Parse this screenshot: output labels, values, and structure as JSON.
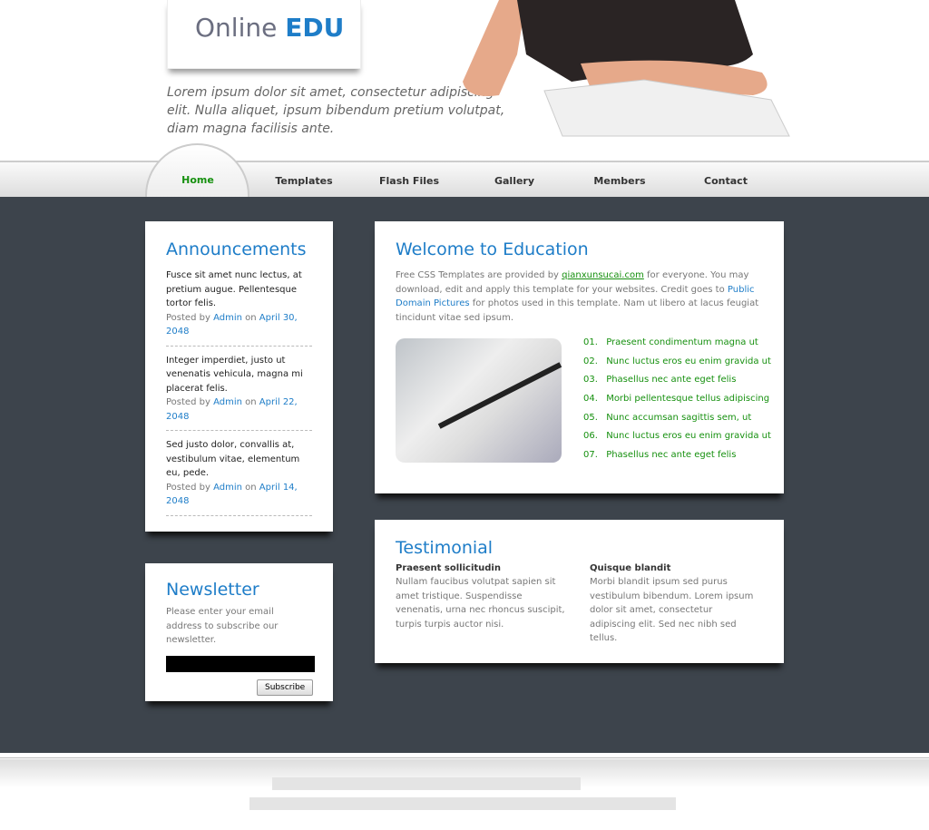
{
  "header": {
    "logo_main": "Online",
    "logo_accent": "EDU",
    "tagline": "Lorem ipsum dolor sit amet, consectetur adipiscing elit. Nulla aliquet, ipsum bibendum pretium volutpat, diam magna facilisis ante."
  },
  "nav": {
    "items": [
      {
        "label": "Home"
      },
      {
        "label": "Templates"
      },
      {
        "label": "Flash Files"
      },
      {
        "label": "Gallery"
      },
      {
        "label": "Members"
      },
      {
        "label": "Contact"
      }
    ],
    "active": "Home"
  },
  "announcements": {
    "title": "Announcements",
    "posted_by": "Posted by",
    "on": "on",
    "posts": [
      {
        "text": "Fusce sit amet nunc lectus, at pretium augue. Pellentesque tortor felis.",
        "author": "Admin",
        "date": "April 30, 2048"
      },
      {
        "text": "Integer imperdiet, justo ut venenatis vehicula, magna mi placerat felis.",
        "author": "Admin",
        "date": "April 22, 2048"
      },
      {
        "text": "Sed justo dolor, convallis at, vestibulum vitae, elementum eu, pede.",
        "author": "Admin",
        "date": "April 14, 2048"
      }
    ]
  },
  "newsletter": {
    "title": "Newsletter",
    "text": "Please enter your email address to subscribe our newsletter.",
    "email_value": "",
    "subscribe": "Subscribe"
  },
  "welcome": {
    "title": "Welcome to Education",
    "p1": "Free CSS Templates are provided by ",
    "link1": "qianxunsucai.com",
    "p2": " for everyone. You may download, edit and apply this template for your websites. Credit goes to ",
    "link2": "Public Domain Pictures",
    "p3": " for photos used in this template. Nam ut libero at lacus feugiat tincidunt vitae sed ipsum.",
    "list": [
      {
        "num": "01.",
        "text": "Praesent condimentum magna ut"
      },
      {
        "num": "02.",
        "text": "Nunc luctus eros eu enim gravida ut"
      },
      {
        "num": "03.",
        "text": "Phasellus nec ante eget felis"
      },
      {
        "num": "04.",
        "text": "Morbi pellentesque tellus adipiscing"
      },
      {
        "num": "05.",
        "text": "Nunc accumsan sagittis sem, ut"
      },
      {
        "num": "06.",
        "text": "Nunc luctus eros eu enim gravida ut"
      },
      {
        "num": "07.",
        "text": "Phasellus nec ante eget felis"
      }
    ]
  },
  "testimonial": {
    "title": "Testimonial",
    "items": [
      {
        "heading": "Praesent sollicitudin",
        "text": "Nullam faucibus volutpat sapien sit amet tristique. Suspendisse venenatis, urna nec rhoncus suscipit, turpis turpis auctor nisi."
      },
      {
        "heading": "Quisque blandit",
        "text": "Morbi blandit ipsum sed purus vestibulum bibendum. Lorem ipsum dolor sit amet, consectetur adipiscing elit. Sed nec nibh sed tellus."
      }
    ]
  },
  "colors": {
    "accent": "#1e7dc8",
    "green": "#16900f",
    "body_bg": "#3d444c"
  }
}
